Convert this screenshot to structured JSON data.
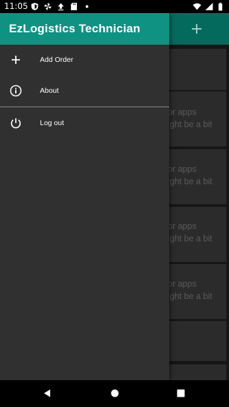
{
  "status_bar": {
    "time": "11:05",
    "left_icons": [
      "shield-icon",
      "pinwheel-icon",
      "upload-icon",
      "sd-card-icon",
      "dot-icon"
    ],
    "right_icons": [
      "wifi-icon",
      "signal-icon",
      "battery-icon"
    ]
  },
  "background": {
    "cards": [
      {
        "line1": "",
        "line2": ""
      },
      {
        "line1": "or apps",
        "line2": "ight be a bit"
      },
      {
        "line1": "or apps",
        "line2": "ight be a bit"
      },
      {
        "line1": "or apps",
        "line2": "ight be a bit"
      },
      {
        "line1": "or apps",
        "line2": "ight be a bit"
      },
      {
        "line1": "",
        "line2": ""
      }
    ]
  },
  "drawer": {
    "title": "EzLogistics Technician",
    "items": [
      {
        "label": "Add Order",
        "icon": "plus-icon"
      },
      {
        "label": "About",
        "icon": "info-icon"
      },
      {
        "label": "Log out",
        "icon": "power-icon"
      }
    ]
  },
  "colors": {
    "drawer_header": "#0f9282",
    "drawer_bg": "#303030",
    "scrim_appbar": "#046a5d"
  },
  "nav_bar": {
    "icons": [
      "back-icon",
      "home-icon",
      "recents-icon"
    ]
  }
}
